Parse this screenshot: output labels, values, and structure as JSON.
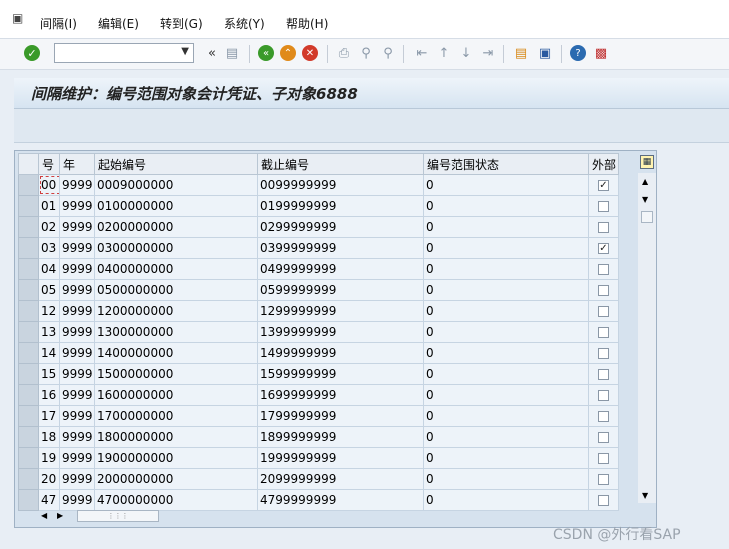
{
  "menubar": {
    "items": [
      {
        "label": "间隔(I)"
      },
      {
        "label": "编辑(E)"
      },
      {
        "label": "转到(G)"
      },
      {
        "label": "系统(Y)"
      },
      {
        "label": "帮助(H)"
      }
    ]
  },
  "toolbar": {
    "command_field": "",
    "icons": [
      "enter-icon",
      "back-icon",
      "exit-icon",
      "cancel-icon",
      "print-icon",
      "find-icon",
      "find-next-icon",
      "first-page-icon",
      "prev-page-icon",
      "next-page-icon",
      "last-page-icon",
      "create-session-icon",
      "shortcut-icon",
      "help-icon",
      "layout-icon"
    ]
  },
  "title": "间隔维护：编号范围对象会计凭证、子对象6888",
  "table": {
    "headers": {
      "no": "号",
      "year": "年",
      "from": "起始编号",
      "to": "截止编号",
      "status": "编号范围状态",
      "ext": "外部"
    },
    "rows": [
      {
        "no": "00",
        "year": "9999",
        "from": "0009000000",
        "to": "0099999999",
        "status": "0",
        "ext": true
      },
      {
        "no": "01",
        "year": "9999",
        "from": "0100000000",
        "to": "0199999999",
        "status": "0",
        "ext": false
      },
      {
        "no": "02",
        "year": "9999",
        "from": "0200000000",
        "to": "0299999999",
        "status": "0",
        "ext": false
      },
      {
        "no": "03",
        "year": "9999",
        "from": "0300000000",
        "to": "0399999999",
        "status": "0",
        "ext": true
      },
      {
        "no": "04",
        "year": "9999",
        "from": "0400000000",
        "to": "0499999999",
        "status": "0",
        "ext": false
      },
      {
        "no": "05",
        "year": "9999",
        "from": "0500000000",
        "to": "0599999999",
        "status": "0",
        "ext": false
      },
      {
        "no": "12",
        "year": "9999",
        "from": "1200000000",
        "to": "1299999999",
        "status": "0",
        "ext": false
      },
      {
        "no": "13",
        "year": "9999",
        "from": "1300000000",
        "to": "1399999999",
        "status": "0",
        "ext": false
      },
      {
        "no": "14",
        "year": "9999",
        "from": "1400000000",
        "to": "1499999999",
        "status": "0",
        "ext": false
      },
      {
        "no": "15",
        "year": "9999",
        "from": "1500000000",
        "to": "1599999999",
        "status": "0",
        "ext": false
      },
      {
        "no": "16",
        "year": "9999",
        "from": "1600000000",
        "to": "1699999999",
        "status": "0",
        "ext": false
      },
      {
        "no": "17",
        "year": "9999",
        "from": "1700000000",
        "to": "1799999999",
        "status": "0",
        "ext": false
      },
      {
        "no": "18",
        "year": "9999",
        "from": "1800000000",
        "to": "1899999999",
        "status": "0",
        "ext": false
      },
      {
        "no": "19",
        "year": "9999",
        "from": "1900000000",
        "to": "1999999999",
        "status": "0",
        "ext": false
      },
      {
        "no": "20",
        "year": "9999",
        "from": "2000000000",
        "to": "2099999999",
        "status": "0",
        "ext": false
      },
      {
        "no": "47",
        "year": "9999",
        "from": "4700000000",
        "to": "4799999999",
        "status": "0",
        "ext": false
      }
    ]
  },
  "watermark": "CSDN @外行看SAP",
  "colors": {
    "accent_green": "#3a9a2a",
    "accent_orange": "#e08a1a",
    "accent_red": "#d23a2a"
  }
}
